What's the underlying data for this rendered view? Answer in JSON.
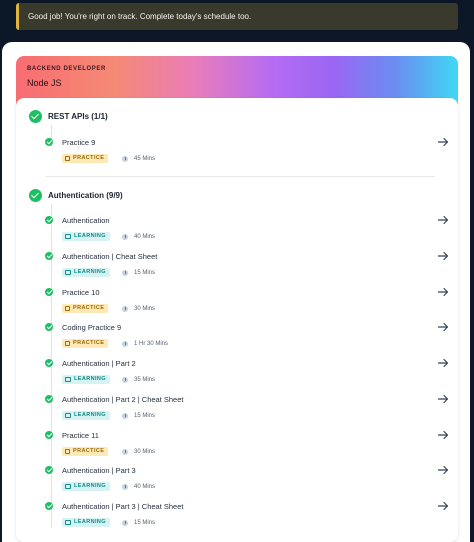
{
  "toast": {
    "message": "Good job! You're right on track. Complete today's schedule too."
  },
  "banner": {
    "eyebrow": "BACKEND DEVELOPER",
    "track": "Node JS"
  },
  "colors": {
    "success": "#1fbd64",
    "practice_bg": "#fde9b5",
    "learning_bg": "#d6f3f3",
    "accent_border": "#e0b43a"
  },
  "sections": [
    {
      "title": "REST APIs (1/1)",
      "items": [
        {
          "name": "Practice 9",
          "type": "PRACTICE",
          "duration": "45 Mins"
        }
      ]
    },
    {
      "title": "Authentication (9/9)",
      "items": [
        {
          "name": "Authentication",
          "type": "LEARNING",
          "duration": "40 Mins"
        },
        {
          "name": "Authentication | Cheat Sheet",
          "type": "LEARNING",
          "duration": "15 Mins"
        },
        {
          "name": "Practice 10",
          "type": "PRACTICE",
          "duration": "30 Mins"
        },
        {
          "name": "Coding Practice 9",
          "type": "PRACTICE",
          "duration": "1 Hr 30 Mins"
        },
        {
          "name": "Authentication | Part 2",
          "type": "LEARNING",
          "duration": "35 Mins"
        },
        {
          "name": "Authentication | Part 2 | Cheat Sheet",
          "type": "LEARNING",
          "duration": "15 Mins"
        },
        {
          "name": "Practice 11",
          "type": "PRACTICE",
          "duration": "30 Mins"
        },
        {
          "name": "Authentication | Part 3",
          "type": "LEARNING",
          "duration": "40 Mins"
        },
        {
          "name": "Authentication | Part 3 | Cheat Sheet",
          "type": "LEARNING",
          "duration": "15 Mins"
        }
      ]
    }
  ],
  "icons": {
    "done": "check-circle-icon",
    "open": "arrow-right-icon",
    "time": "clock-icon",
    "practice": "clipboard-icon",
    "learning": "book-icon"
  }
}
